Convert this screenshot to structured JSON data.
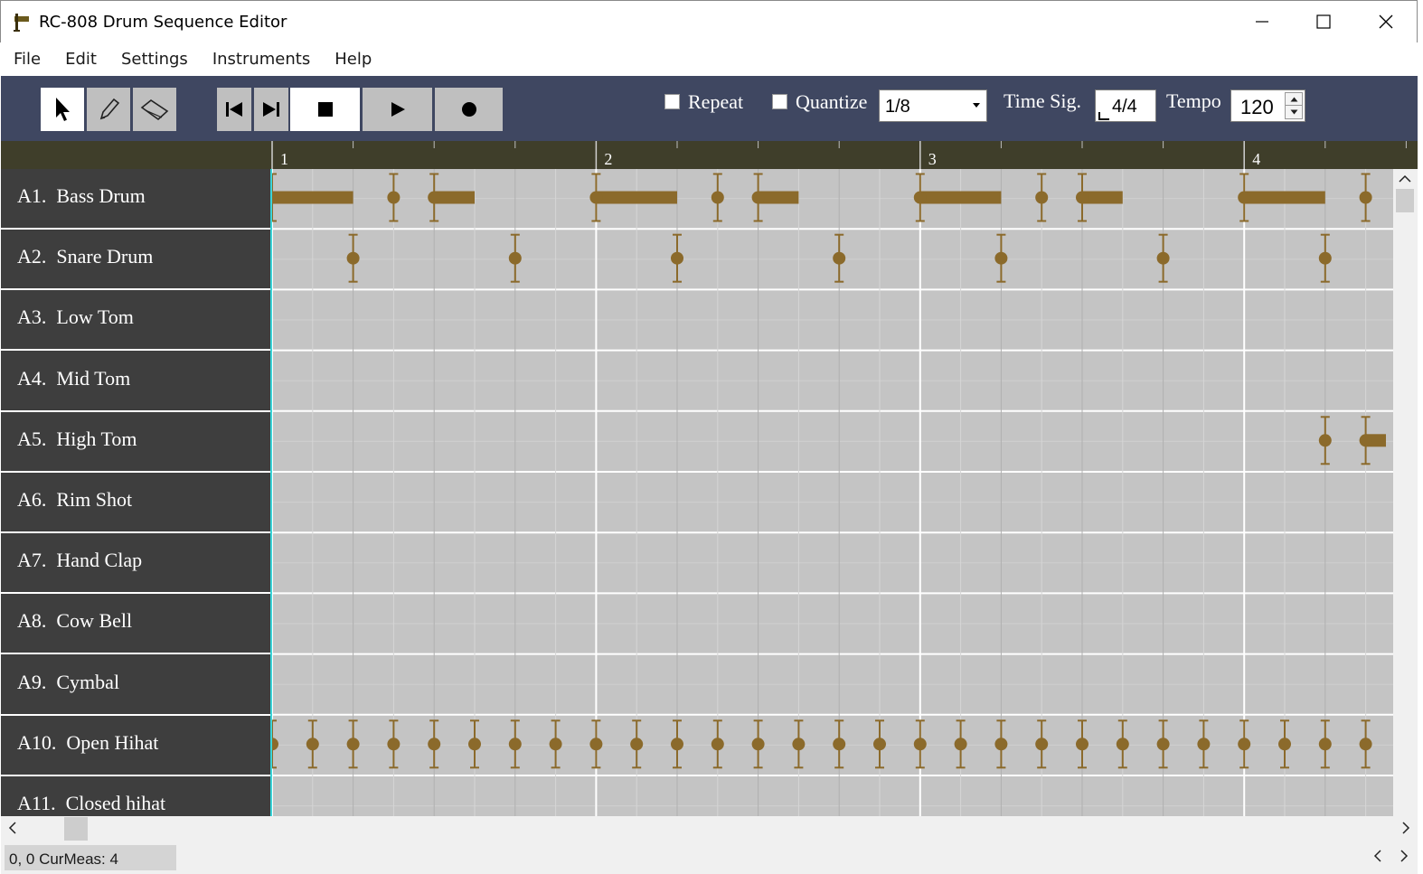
{
  "window": {
    "title": "RC-808 Drum Sequence Editor",
    "icon": "drum-app-icon",
    "controls": [
      "minimize-icon",
      "maximize-icon",
      "close-icon"
    ]
  },
  "menu": [
    "File",
    "Edit",
    "Settings",
    "Instruments",
    "Help"
  ],
  "toolbar": {
    "tools": [
      {
        "name": "select-tool",
        "icon": "arrow-cursor-icon",
        "active": true
      },
      {
        "name": "pencil-tool",
        "icon": "pencil-icon",
        "active": false
      },
      {
        "name": "eraser-tool",
        "icon": "eraser-icon",
        "active": false
      }
    ],
    "transport": [
      {
        "name": "skip-to-start",
        "icon": "skip-back-icon"
      },
      {
        "name": "skip-to-end",
        "icon": "skip-forward-icon"
      },
      {
        "name": "stop",
        "icon": "stop-icon",
        "active": true
      },
      {
        "name": "play",
        "icon": "play-icon"
      },
      {
        "name": "record",
        "icon": "record-icon"
      }
    ],
    "repeat_label": "Repeat",
    "repeat_checked": false,
    "quantize_label": "Quantize",
    "quantize_checked": false,
    "quantize_value": "1/8",
    "timesig_label": "Time Sig.",
    "timesig_value": "4/4",
    "tempo_label": "Tempo",
    "tempo_value": "120"
  },
  "ruler": {
    "measures": [
      "1",
      "2",
      "3",
      "4"
    ]
  },
  "tracks": [
    {
      "id": "A1.",
      "name": "Bass Drum"
    },
    {
      "id": "A2.",
      "name": "Snare Drum"
    },
    {
      "id": "A3.",
      "name": "Low Tom"
    },
    {
      "id": "A4.",
      "name": "Mid Tom"
    },
    {
      "id": "A5.",
      "name": "High Tom"
    },
    {
      "id": "A6.",
      "name": "Rim Shot"
    },
    {
      "id": "A7.",
      "name": "Hand Clap"
    },
    {
      "id": "A8.",
      "name": "Cow Bell"
    },
    {
      "id": "A9.",
      "name": "Cymbal"
    },
    {
      "id": "A10.",
      "name": "Open Hihat"
    },
    {
      "id": "A11.",
      "name": "Closed hihat"
    }
  ],
  "notes": {
    "unit": "eighth-note steps from start of measure 1",
    "track_0": [
      {
        "step": 0,
        "length": 2
      },
      {
        "step": 3,
        "length": 0
      },
      {
        "step": 4,
        "length": 1
      },
      {
        "step": 8,
        "length": 2
      },
      {
        "step": 11,
        "length": 0
      },
      {
        "step": 12,
        "length": 1
      },
      {
        "step": 16,
        "length": 2
      },
      {
        "step": 19,
        "length": 0
      },
      {
        "step": 20,
        "length": 1
      },
      {
        "step": 24,
        "length": 2
      },
      {
        "step": 27,
        "length": 0
      }
    ],
    "track_1": [
      {
        "step": 2,
        "length": 0
      },
      {
        "step": 6,
        "length": 0
      },
      {
        "step": 10,
        "length": 0
      },
      {
        "step": 14,
        "length": 0
      },
      {
        "step": 18,
        "length": 0
      },
      {
        "step": 22,
        "length": 0
      },
      {
        "step": 26,
        "length": 0
      }
    ],
    "track_4": [
      {
        "step": 26,
        "length": 0
      },
      {
        "step": 27,
        "length": 0.5
      }
    ],
    "track_9": [
      {
        "step": 0,
        "length": 0
      },
      {
        "step": 1,
        "length": 0
      },
      {
        "step": 2,
        "length": 0
      },
      {
        "step": 3,
        "length": 0
      },
      {
        "step": 4,
        "length": 0
      },
      {
        "step": 5,
        "length": 0
      },
      {
        "step": 6,
        "length": 0
      },
      {
        "step": 7,
        "length": 0
      },
      {
        "step": 8,
        "length": 0
      },
      {
        "step": 9,
        "length": 0
      },
      {
        "step": 10,
        "length": 0
      },
      {
        "step": 11,
        "length": 0
      },
      {
        "step": 12,
        "length": 0
      },
      {
        "step": 13,
        "length": 0
      },
      {
        "step": 14,
        "length": 0
      },
      {
        "step": 15,
        "length": 0
      },
      {
        "step": 16,
        "length": 0
      },
      {
        "step": 17,
        "length": 0
      },
      {
        "step": 18,
        "length": 0
      },
      {
        "step": 19,
        "length": 0
      },
      {
        "step": 20,
        "length": 0
      },
      {
        "step": 21,
        "length": 0
      },
      {
        "step": 22,
        "length": 0
      },
      {
        "step": 23,
        "length": 0
      },
      {
        "step": 24,
        "length": 0
      },
      {
        "step": 25,
        "length": 0
      },
      {
        "step": 26,
        "length": 0
      },
      {
        "step": 27,
        "length": 0
      }
    ]
  },
  "colors": {
    "toolbar_bg": "#3f4761",
    "ruler_bg": "#3f3e2a",
    "track_panel_bg": "#3e3e3e",
    "grid_bg": "#c4c4c4",
    "note_color": "#8b6a2b",
    "playhead": "#3ad4d8"
  },
  "status": {
    "text": "0, 0  CurMeas: 4"
  }
}
